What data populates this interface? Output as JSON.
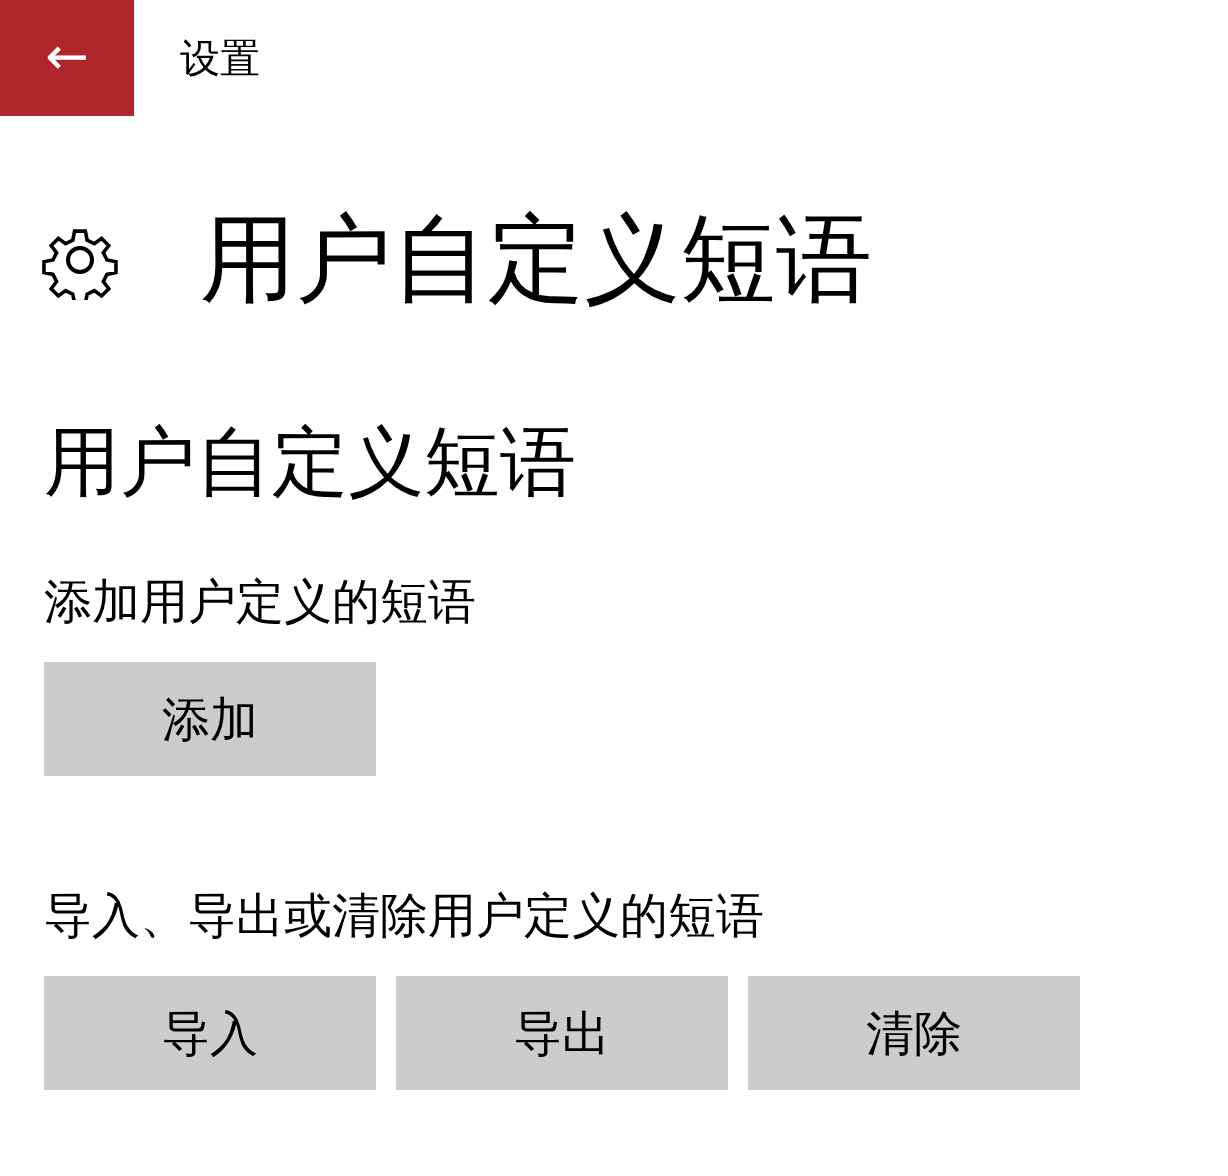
{
  "header": {
    "back_icon": "←",
    "title": "设置"
  },
  "page_title": "用户自定义短语",
  "section_title": "用户自定义短语",
  "groups": [
    {
      "label": "添加用户定义的短语",
      "buttons": [
        "添加"
      ]
    },
    {
      "label": "导入、导出或清除用户定义的短语",
      "buttons": [
        "导入",
        "导出",
        "清除"
      ]
    }
  ]
}
